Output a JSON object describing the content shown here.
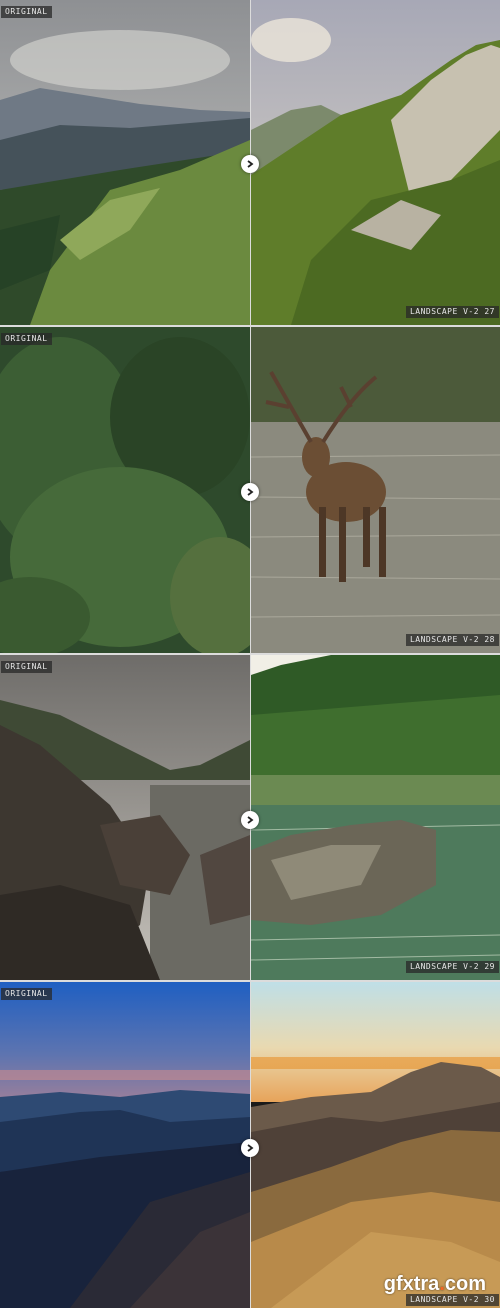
{
  "panels": [
    {
      "original_label": "ORIGINAL",
      "preset_label": "LANDSCAPE V-2 27"
    },
    {
      "original_label": "ORIGINAL",
      "preset_label": "LANDSCAPE V-2 28"
    },
    {
      "original_label": "ORIGINAL",
      "preset_label": "LANDSCAPE V-2 29"
    },
    {
      "original_label": "ORIGINAL",
      "preset_label": "LANDSCAPE V-2 30"
    }
  ],
  "watermark": {
    "left": "gfxtra",
    "dot": ".",
    "right": "com"
  },
  "colors": {
    "watermark_accent": "#f26522"
  }
}
